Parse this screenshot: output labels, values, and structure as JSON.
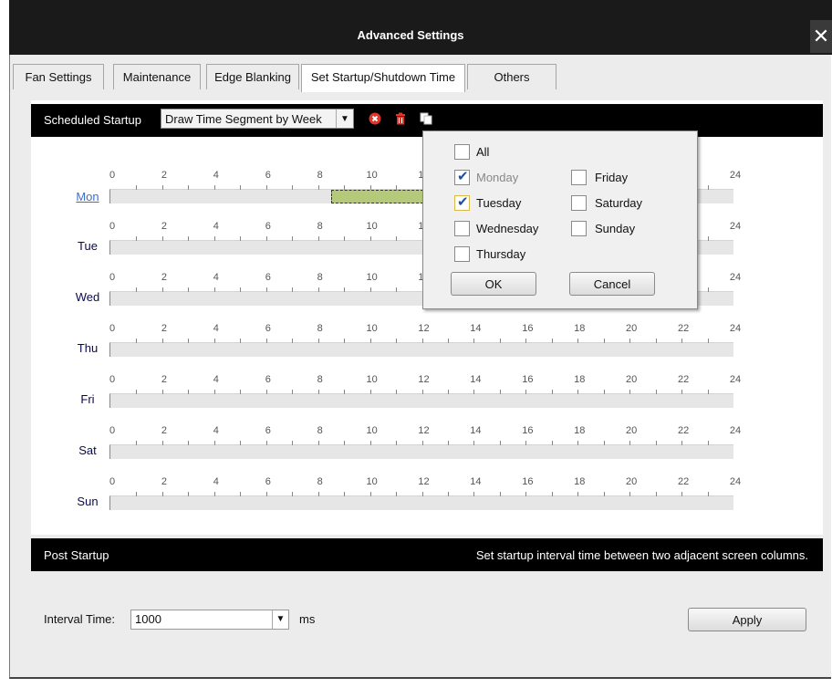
{
  "window": {
    "title": "Advanced Settings",
    "close_label": "✕"
  },
  "tabs": [
    {
      "label": "Fan Settings",
      "active": false
    },
    {
      "label": "Maintenance",
      "active": false
    },
    {
      "label": "Edge Blanking",
      "active": false
    },
    {
      "label": "Set Startup/Shutdown Time",
      "active": true
    },
    {
      "label": "Others",
      "active": false
    }
  ],
  "toolbar": {
    "label": "Scheduled Startup",
    "mode_value": "Draw Time Segment by Week",
    "icons": [
      "delete-circle-icon",
      "trash-icon",
      "copy-icon"
    ]
  },
  "schedule": {
    "hours": [
      "0",
      "2",
      "4",
      "6",
      "8",
      "10",
      "12",
      "14",
      "16",
      "18",
      "20",
      "22",
      "24"
    ],
    "days": [
      {
        "label": "Mon",
        "selected": true,
        "segment_hours": [
          8.5,
          12
        ]
      },
      {
        "label": "Tue"
      },
      {
        "label": "Wed"
      },
      {
        "label": "Thu"
      },
      {
        "label": "Fri"
      },
      {
        "label": "Sat"
      },
      {
        "label": "Sun"
      }
    ]
  },
  "copy_popup": {
    "all": {
      "label": "All",
      "checked": false
    },
    "days": {
      "monday": {
        "label": "Monday",
        "checked": true,
        "disabled": true
      },
      "tuesday": {
        "label": "Tuesday",
        "checked": true
      },
      "wednesday": {
        "label": "Wednesday",
        "checked": false
      },
      "thursday": {
        "label": "Thursday",
        "checked": false
      },
      "friday": {
        "label": "Friday",
        "checked": false
      },
      "saturday": {
        "label": "Saturday",
        "checked": false
      },
      "sunday": {
        "label": "Sunday",
        "checked": false
      }
    },
    "ok_label": "OK",
    "cancel_label": "Cancel"
  },
  "post_startup": {
    "label": "Post Startup",
    "hint": "Set startup interval time between two adjacent screen columns.",
    "interval_label": "Interval Time:",
    "interval_value": "1000",
    "unit": "ms",
    "apply_label": "Apply"
  },
  "colors": {
    "segment": "#b5c97a",
    "header_bar": "#000000",
    "selected_day": "#3a6fcf"
  }
}
